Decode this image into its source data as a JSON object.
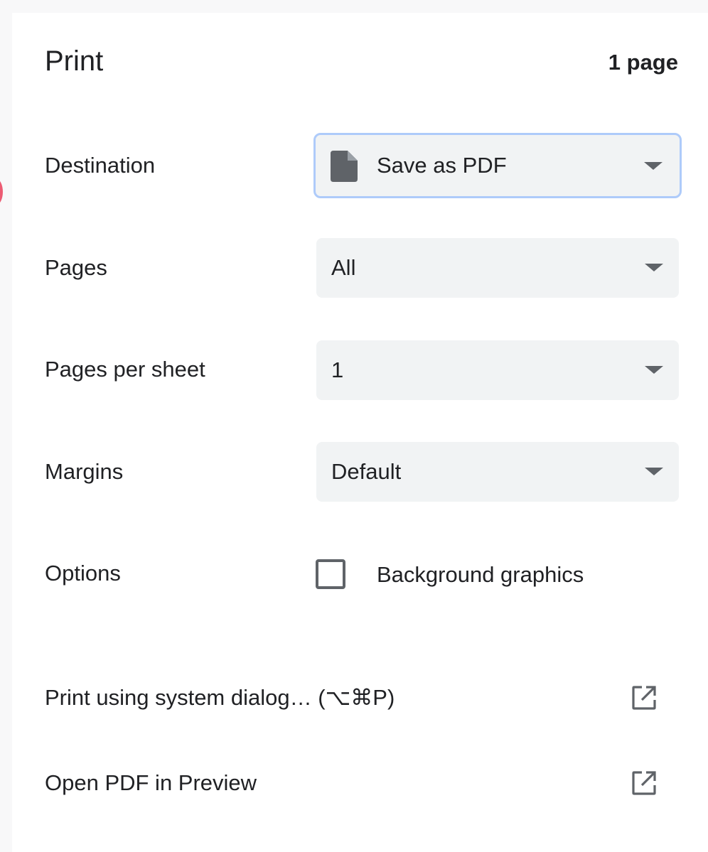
{
  "header": {
    "title": "Print",
    "page_count": "1 page"
  },
  "settings": {
    "destination": {
      "label": "Destination",
      "value": "Save as PDF",
      "icon": "document-icon"
    },
    "pages": {
      "label": "Pages",
      "value": "All"
    },
    "pages_per_sheet": {
      "label": "Pages per sheet",
      "value": "1"
    },
    "margins": {
      "label": "Margins",
      "value": "Default"
    },
    "options": {
      "label": "Options",
      "background_graphics_label": "Background graphics",
      "background_graphics_checked": false
    }
  },
  "links": [
    {
      "label": "Print using system dialog… (⌥⌘P)",
      "icon": "open-external-icon"
    },
    {
      "label": "Open PDF in Preview",
      "icon": "open-external-icon"
    }
  ],
  "colors": {
    "focus_ring": "#aecbfa",
    "select_background": "#f1f3f4",
    "icon_gray": "#5f6368",
    "edge_accent": "#ec5b73"
  }
}
